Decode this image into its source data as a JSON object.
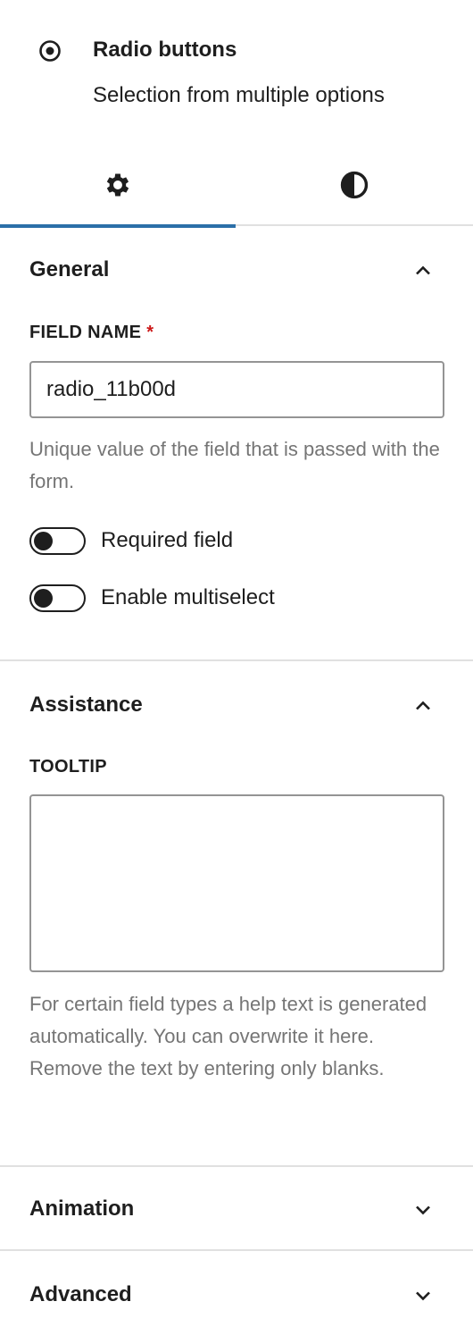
{
  "block": {
    "icon": "radio-selected-icon",
    "title": "Radio buttons",
    "description": "Selection from multiple options"
  },
  "tabs": [
    {
      "name": "settings",
      "icon": "gear-icon",
      "active": true
    },
    {
      "name": "styles",
      "icon": "half-circle-contrast-icon",
      "active": false
    }
  ],
  "panels": {
    "general": {
      "title": "General",
      "expanded": true,
      "field_name_label": "FIELD NAME",
      "required_marker": "*",
      "field_name_value": "radio_11b00d",
      "field_name_help": "Unique value of the field that is passed with the form.",
      "required_toggle_label": "Required field",
      "required_toggle_on": false,
      "multiselect_toggle_label": "Enable multiselect",
      "multiselect_toggle_on": false
    },
    "assistance": {
      "title": "Assistance",
      "expanded": true,
      "tooltip_label": "TOOLTIP",
      "tooltip_value": "",
      "tooltip_help": "For certain field types a help text is generated automatically. You can overwrite it here. Remove the text by entering only blanks."
    },
    "animation": {
      "title": "Animation",
      "expanded": false
    },
    "advanced": {
      "title": "Advanced",
      "expanded": false
    }
  },
  "colors": {
    "accent": "#2b6fa8",
    "required": "#cc1818",
    "help_text": "#757575",
    "divider": "#e0e0e0"
  }
}
